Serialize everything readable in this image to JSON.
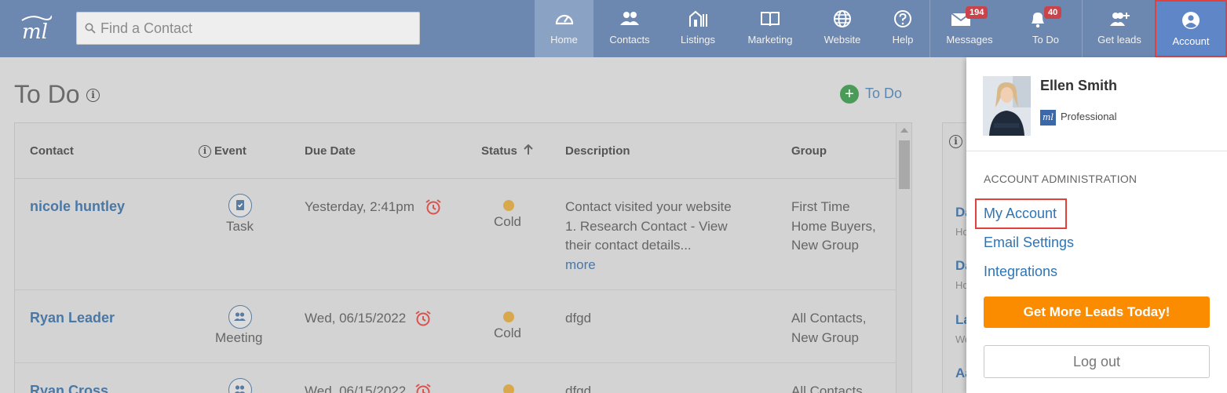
{
  "header": {
    "logo_text": "ml",
    "search_placeholder": "Find a Contact",
    "nav": [
      {
        "key": "home",
        "label": "Home",
        "icon": "dashboard-gauge-icon"
      },
      {
        "key": "contacts",
        "label": "Contacts",
        "icon": "people-icon"
      },
      {
        "key": "listings",
        "label": "Listings",
        "icon": "buildings-icon"
      },
      {
        "key": "marketing",
        "label": "Marketing",
        "icon": "open-book-icon"
      },
      {
        "key": "website",
        "label": "Website",
        "icon": "globe-icon"
      },
      {
        "key": "help",
        "label": "Help",
        "icon": "question-circle-icon"
      },
      {
        "key": "messages",
        "label": "Messages",
        "icon": "envelope-icon",
        "badge": "194"
      },
      {
        "key": "todo",
        "label": "To Do",
        "icon": "bell-icon",
        "badge": "40"
      },
      {
        "key": "getleads",
        "label": "Get leads",
        "icon": "add-user-icon"
      },
      {
        "key": "account",
        "label": "Account",
        "icon": "user-circle-icon"
      }
    ]
  },
  "page": {
    "title": "To Do",
    "add_label": "To Do"
  },
  "table": {
    "columns": [
      "Contact",
      "Event",
      "Due Date",
      "Status",
      "Description",
      "Group"
    ],
    "rows": [
      {
        "contact": "nicole huntley",
        "event": "Task",
        "due": "Yesterday, 2:41pm",
        "status": "Cold",
        "description": [
          "Contact visited your website",
          "1. Research Contact - View",
          "their contact details..."
        ],
        "more": "more",
        "group": [
          "First Time",
          "Home Buyers,",
          "New Group"
        ]
      },
      {
        "contact": "Ryan Leader",
        "event": "Meeting",
        "due": "Wed, 06/15/2022",
        "status": "Cold",
        "description": [
          "dfgd"
        ],
        "group": [
          "All Contacts,",
          "New Group"
        ]
      },
      {
        "contact": "Ryan Cross",
        "event": "",
        "due": "Wed, 06/15/2022",
        "status": "",
        "description": [
          "dfgd"
        ],
        "group": [
          "All Contacts,"
        ]
      }
    ]
  },
  "side_peek": {
    "items": [
      {
        "text": "Da",
        "sub": "Ho"
      },
      {
        "text": "Da",
        "sub": "Ho"
      },
      {
        "text": "La",
        "sub": "We"
      },
      {
        "text": "Aa",
        "sub": ""
      }
    ]
  },
  "account_menu": {
    "user_name": "Ellen Smith",
    "plan": "Professional",
    "plan_icon_text": "ml",
    "section_header": "ACCOUNT ADMINISTRATION",
    "links": [
      "My Account",
      "Email Settings",
      "Integrations"
    ],
    "cta": "Get More Leads Today!",
    "logout": "Log out"
  },
  "colors": {
    "nav_bg": "#6c88b0",
    "link_blue": "#2e75b6",
    "cta_orange": "#fb8c00",
    "badge_red": "#c9434b",
    "highlight_red": "#e0413b"
  }
}
